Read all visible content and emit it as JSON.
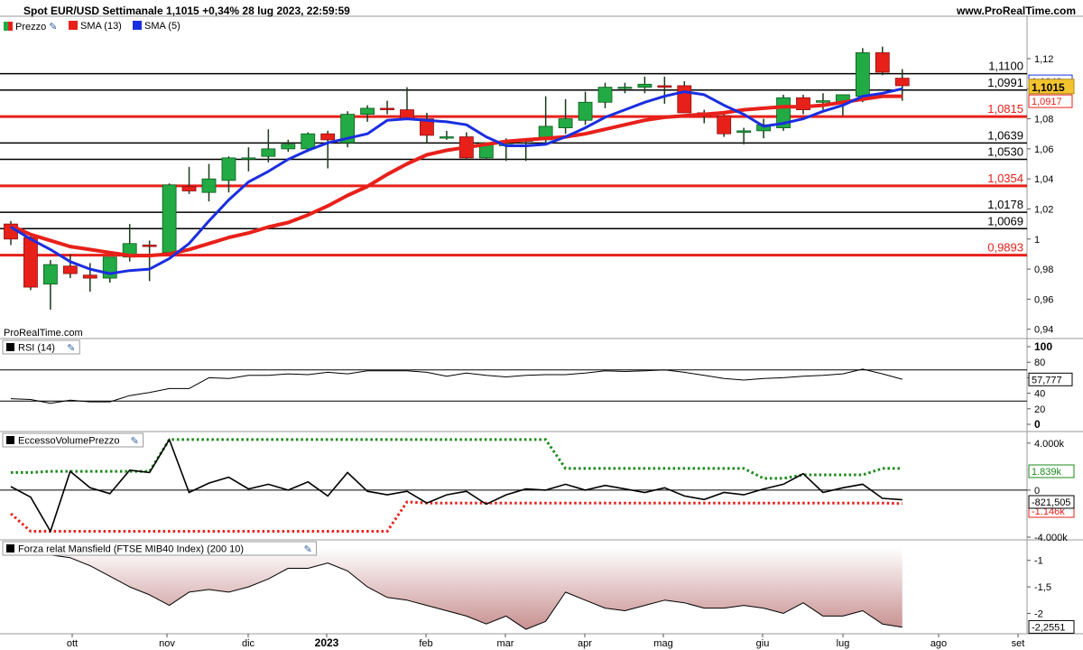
{
  "header": {
    "title": "Spot EUR/USD Settimanale 1,1015 +0,34% 28 lug 2023, 22:59:59",
    "brand": "www.ProRealTime.com"
  },
  "legend": {
    "price": "Prezzo",
    "sma13": "SMA (13)",
    "sma5": "SMA (5)"
  },
  "watermark": "ProRealTime.com",
  "colors": {
    "up": "#22aa44",
    "down": "#e8201a",
    "sma13": "#e8201a",
    "sma5": "#1a2ee0",
    "hline": "#000000",
    "redline": "#e8201a"
  },
  "chart_data": [
    {
      "type": "candlestick",
      "title": "Spot EUR/USD Settimanale",
      "ylim": [
        0.935,
        1.135
      ],
      "y_ticks": [
        "1,12",
        "1,1",
        "1,08",
        "1,06",
        "1,04",
        "1,02",
        "1",
        "0,98",
        "0,96",
        "0,94"
      ],
      "y_tick_values": [
        1.12,
        1.1,
        1.08,
        1.06,
        1.04,
        1.02,
        1.0,
        0.98,
        0.96,
        0.94
      ],
      "x_tick_labels": [
        "ott",
        "nov",
        "dic",
        "2023",
        "feb",
        "mar",
        "apr",
        "mag",
        "giu",
        "lug",
        "ago",
        "set"
      ],
      "candles": [
        {
          "o": 1.01,
          "h": 1.012,
          "l": 0.996,
          "c": 1.0
        },
        {
          "o": 1.001,
          "h": 1.004,
          "l": 0.966,
          "c": 0.968
        },
        {
          "o": 0.97,
          "h": 0.986,
          "l": 0.953,
          "c": 0.983
        },
        {
          "o": 0.982,
          "h": 0.99,
          "l": 0.974,
          "c": 0.977
        },
        {
          "o": 0.976,
          "h": 0.984,
          "l": 0.965,
          "c": 0.974
        },
        {
          "o": 0.974,
          "h": 0.988,
          "l": 0.971,
          "c": 0.988
        },
        {
          "o": 0.988,
          "h": 1.01,
          "l": 0.985,
          "c": 0.997
        },
        {
          "o": 0.996,
          "h": 0.999,
          "l": 0.972,
          "c": 0.995
        },
        {
          "o": 0.991,
          "h": 1.037,
          "l": 0.99,
          "c": 1.036
        },
        {
          "o": 1.035,
          "h": 1.048,
          "l": 1.03,
          "c": 1.032
        },
        {
          "o": 1.031,
          "h": 1.05,
          "l": 1.025,
          "c": 1.04
        },
        {
          "o": 1.039,
          "h": 1.055,
          "l": 1.031,
          "c": 1.054
        },
        {
          "o": 1.054,
          "h": 1.061,
          "l": 1.045,
          "c": 1.054
        },
        {
          "o": 1.055,
          "h": 1.073,
          "l": 1.051,
          "c": 1.06
        },
        {
          "o": 1.06,
          "h": 1.066,
          "l": 1.058,
          "c": 1.063
        },
        {
          "o": 1.06,
          "h": 1.071,
          "l": 1.058,
          "c": 1.07
        },
        {
          "o": 1.07,
          "h": 1.072,
          "l": 1.047,
          "c": 1.066
        },
        {
          "o": 1.064,
          "h": 1.085,
          "l": 1.061,
          "c": 1.083
        },
        {
          "o": 1.083,
          "h": 1.089,
          "l": 1.078,
          "c": 1.087
        },
        {
          "o": 1.087,
          "h": 1.092,
          "l": 1.083,
          "c": 1.086
        },
        {
          "o": 1.086,
          "h": 1.101,
          "l": 1.081,
          "c": 1.08
        },
        {
          "o": 1.08,
          "h": 1.084,
          "l": 1.064,
          "c": 1.069
        },
        {
          "o": 1.068,
          "h": 1.072,
          "l": 1.066,
          "c": 1.068
        },
        {
          "o": 1.068,
          "h": 1.071,
          "l": 1.053,
          "c": 1.054
        },
        {
          "o": 1.054,
          "h": 1.064,
          "l": 1.053,
          "c": 1.064
        },
        {
          "o": 1.063,
          "h": 1.067,
          "l": 1.052,
          "c": 1.063
        },
        {
          "o": 1.065,
          "h": 1.067,
          "l": 1.052,
          "c": 1.066
        },
        {
          "o": 1.066,
          "h": 1.095,
          "l": 1.063,
          "c": 1.075
        },
        {
          "o": 1.074,
          "h": 1.093,
          "l": 1.07,
          "c": 1.08
        },
        {
          "o": 1.079,
          "h": 1.098,
          "l": 1.076,
          "c": 1.091
        },
        {
          "o": 1.091,
          "h": 1.104,
          "l": 1.087,
          "c": 1.101
        },
        {
          "o": 1.101,
          "h": 1.104,
          "l": 1.097,
          "c": 1.101
        },
        {
          "o": 1.101,
          "h": 1.108,
          "l": 1.097,
          "c": 1.103
        },
        {
          "o": 1.102,
          "h": 1.108,
          "l": 1.09,
          "c": 1.101
        },
        {
          "o": 1.102,
          "h": 1.105,
          "l": 1.084,
          "c": 1.084
        },
        {
          "o": 1.084,
          "h": 1.086,
          "l": 1.077,
          "c": 1.082
        },
        {
          "o": 1.082,
          "h": 1.084,
          "l": 1.068,
          "c": 1.07
        },
        {
          "o": 1.071,
          "h": 1.074,
          "l": 1.063,
          "c": 1.072
        },
        {
          "o": 1.072,
          "h": 1.08,
          "l": 1.067,
          "c": 1.076
        },
        {
          "o": 1.074,
          "h": 1.096,
          "l": 1.072,
          "c": 1.094
        },
        {
          "o": 1.094,
          "h": 1.096,
          "l": 1.083,
          "c": 1.086
        },
        {
          "o": 1.091,
          "h": 1.097,
          "l": 1.086,
          "c": 1.092
        },
        {
          "o": 1.091,
          "h": 1.096,
          "l": 1.082,
          "c": 1.096
        },
        {
          "o": 1.095,
          "h": 1.127,
          "l": 1.091,
          "c": 1.124
        },
        {
          "o": 1.124,
          "h": 1.128,
          "l": 1.109,
          "c": 1.111
        },
        {
          "o": 1.107,
          "h": 1.113,
          "l": 1.092,
          "c": 1.102
        }
      ],
      "sma13": [
        1.009,
        1.003,
        0.999,
        0.995,
        0.993,
        0.991,
        0.989,
        0.989,
        0.99,
        0.993,
        0.997,
        1.001,
        1.004,
        1.008,
        1.011,
        1.016,
        1.022,
        1.029,
        1.035,
        1.043,
        1.05,
        1.056,
        1.059,
        1.061,
        1.063,
        1.065,
        1.066,
        1.067,
        1.068,
        1.07,
        1.073,
        1.076,
        1.079,
        1.081,
        1.082,
        1.083,
        1.084,
        1.086,
        1.087,
        1.088,
        1.088,
        1.089,
        1.091,
        1.093,
        1.095,
        1.095
      ],
      "sma5": [
        1.008,
        1.0,
        0.993,
        0.985,
        0.98,
        0.977,
        0.979,
        0.98,
        0.987,
        0.997,
        1.012,
        1.026,
        1.038,
        1.045,
        1.053,
        1.059,
        1.064,
        1.067,
        1.07,
        1.079,
        1.08,
        1.079,
        1.078,
        1.076,
        1.068,
        1.062,
        1.062,
        1.063,
        1.068,
        1.074,
        1.081,
        1.086,
        1.091,
        1.095,
        1.098,
        1.096,
        1.089,
        1.083,
        1.075,
        1.077,
        1.08,
        1.085,
        1.089,
        1.095,
        1.097,
        1.1
      ],
      "hlines": [
        {
          "value": 1.11,
          "label": "1,1100",
          "kind": "black"
        },
        {
          "value": 1.0991,
          "label": "1,0991",
          "kind": "black"
        },
        {
          "value": 1.0815,
          "label": "1,0815",
          "kind": "red"
        },
        {
          "value": 1.0639,
          "label": "1,0639",
          "kind": "black"
        },
        {
          "value": 1.053,
          "label": "1,0530",
          "kind": "black"
        },
        {
          "value": 1.0354,
          "label": "1,0354",
          "kind": "red"
        },
        {
          "value": 1.0178,
          "label": "1,0178",
          "kind": "black"
        },
        {
          "value": 1.0069,
          "label": "1,0069",
          "kind": "black"
        },
        {
          "value": 0.9893,
          "label": "0,9893",
          "kind": "red"
        }
      ],
      "axis_badges": [
        {
          "value": 1.1049,
          "label": "1,1049",
          "kind": "blue"
        },
        {
          "value": 1.1015,
          "label": "1,1015",
          "kind": "last"
        },
        {
          "value": 1.0917,
          "label": "1,0917",
          "kind": "red"
        }
      ]
    },
    {
      "type": "line",
      "title": "RSI (14)",
      "ylim": [
        0,
        100
      ],
      "y_ticks": [
        "100",
        "80",
        "60",
        "40",
        "20",
        "0"
      ],
      "y_tick_values": [
        100,
        80,
        60,
        40,
        20,
        0
      ],
      "levels": [
        70,
        30
      ],
      "last_label": "57,777",
      "values": [
        33,
        32,
        27,
        31,
        29,
        29,
        37,
        41,
        46,
        46,
        60,
        59,
        63,
        63,
        65,
        64,
        67,
        65,
        69,
        69,
        69,
        67,
        62,
        66,
        63,
        61,
        63,
        64,
        64,
        66,
        69,
        68,
        69,
        70,
        67,
        63,
        59,
        57,
        59,
        60,
        62,
        63,
        65,
        71,
        65,
        58
      ]
    },
    {
      "type": "line",
      "title": "EccessoVolumePrezzo",
      "ylim": [
        -4000,
        4600
      ],
      "y_ticks": [
        "4.000k",
        "0",
        "-4.000k"
      ],
      "y_tick_values": [
        4000,
        0,
        -4000
      ],
      "series": [
        {
          "label": "1.839k",
          "kind": "green-dotted",
          "values": [
            1500,
            1500,
            1600,
            1600,
            1600,
            1600,
            1600,
            1600,
            4300,
            4300,
            4300,
            4300,
            4300,
            4300,
            4300,
            4300,
            4300,
            4300,
            4300,
            4300,
            4300,
            4300,
            4300,
            4300,
            4300,
            4300,
            4300,
            4300,
            1840,
            1840,
            1840,
            1840,
            1840,
            1840,
            1840,
            1840,
            1840,
            1840,
            1000,
            1000,
            1300,
            1300,
            1300,
            1300,
            1840,
            1840
          ]
        },
        {
          "label": "-1.146k",
          "kind": "red-dotted",
          "values": [
            -2000,
            -3500,
            -3500,
            -3500,
            -3500,
            -3500,
            -3500,
            -3500,
            -3500,
            -3500,
            -3500,
            -3500,
            -3500,
            -3500,
            -3500,
            -3500,
            -3500,
            -3500,
            -3500,
            -3500,
            -1000,
            -1100,
            -1100,
            -1100,
            -1100,
            -1100,
            -1100,
            -1100,
            -1100,
            -1100,
            -1100,
            -1100,
            -1100,
            -1100,
            -1100,
            -1100,
            -1100,
            -1100,
            -1100,
            -1100,
            -1100,
            -1100,
            -1100,
            -1100,
            -1100,
            -1146
          ]
        },
        {
          "label": "-821,505",
          "kind": "black",
          "values": [
            300,
            -600,
            -3500,
            1600,
            200,
            -300,
            1700,
            1500,
            4300,
            -200,
            600,
            1100,
            100,
            500,
            0,
            700,
            -500,
            1500,
            -100,
            -400,
            -100,
            -1100,
            -400,
            -100,
            -1200,
            -400,
            100,
            0,
            500,
            0,
            400,
            100,
            -200,
            200,
            -500,
            -800,
            -200,
            -400,
            100,
            500,
            1400,
            -200,
            200,
            500,
            -700,
            -821
          ]
        }
      ]
    },
    {
      "type": "area",
      "title": "Forza relat Mansfield (FTSE MIB40 Index) (200 10)",
      "ylim": [
        -2.35,
        -0.75
      ],
      "y_ticks": [
        "-1",
        "-1,5",
        "-2"
      ],
      "y_tick_values": [
        -1,
        -1.5,
        -2
      ],
      "last_label": "-2,2551",
      "values": [
        -0.9,
        -0.9,
        -0.9,
        -0.95,
        -1.1,
        -1.3,
        -1.5,
        -1.65,
        -1.85,
        -1.6,
        -1.55,
        -1.6,
        -1.5,
        -1.35,
        -1.15,
        -1.15,
        -1.05,
        -1.2,
        -1.5,
        -1.7,
        -1.75,
        -1.85,
        -1.95,
        -2.05,
        -2.2,
        -2.05,
        -2.3,
        -2.15,
        -1.6,
        -1.75,
        -1.9,
        -1.95,
        -1.85,
        -1.75,
        -1.8,
        -1.9,
        -1.9,
        -1.85,
        -1.9,
        -2.0,
        -1.8,
        -2.05,
        -2.05,
        -1.95,
        -2.2,
        -2.26
      ]
    }
  ]
}
